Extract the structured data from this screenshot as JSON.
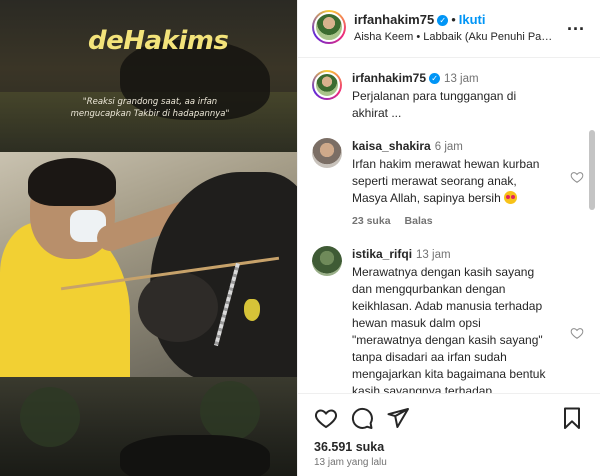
{
  "media": {
    "brand": "deHakims",
    "caption": "\"Reaksi grandong saat, aa irfan mengucapkan Takbir di hadapannya\""
  },
  "header": {
    "username": "irfanhakim75",
    "separator": "•",
    "follow_label": "Ikuti",
    "music": "Aisha Keem • Labbaik (Aku Penuhi Panggilan-Mu)",
    "more_label": "..."
  },
  "comments": [
    {
      "username": "irfanhakim75",
      "time": "13 jam",
      "text": "Perjalanan para tunggangan di akhirat ...",
      "is_caption": true
    },
    {
      "username": "kaisa_shakira",
      "time": "6 jam",
      "text": "Irfan hakim merawat hewan kurban seperti merawat seorang anak, Masya Allah, sapinya bersih",
      "likes": "23 suka",
      "reply_label": "Balas"
    },
    {
      "username": "istika_rifqi",
      "time": "13 jam",
      "text": "Merawatnya dengan kasih sayang dan mengqurbankan dengan keikhlasan. Adab manusia terhadap hewan masuk dalm opsi \"merawatnya dengan kasih sayang\" tanpa disadari aa irfan sudah mengajarkan kita bagaimana bentuk kasih sayangnya terhadap"
    }
  ],
  "actions": {
    "likes": "36.591 suka",
    "time_ago": "13 jam yang lalu"
  },
  "colors": {
    "accent": "#0095f6",
    "muted": "#737373",
    "text": "#262626"
  },
  "icons": [
    "verified-badge-icon",
    "more-icon",
    "heart-icon",
    "comment-icon",
    "share-icon",
    "bookmark-icon"
  ]
}
